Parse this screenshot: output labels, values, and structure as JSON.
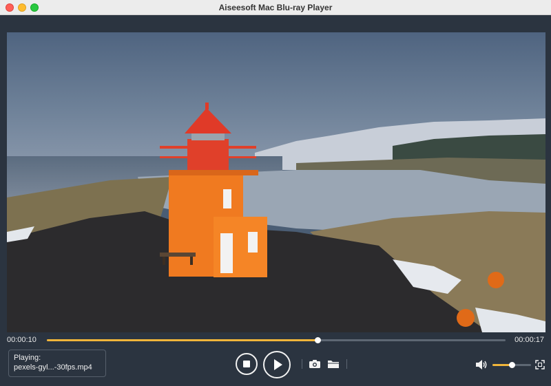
{
  "window": {
    "title": "Aiseesoft Mac Blu-ray Player"
  },
  "video": {
    "scene": "lighthouse-landscape"
  },
  "playback": {
    "current_time": "00:00:10",
    "duration": "00:00:17",
    "progress_fraction": 0.59,
    "volume_fraction": 0.5
  },
  "now_playing": {
    "label": "Playing:",
    "filename": "pexels-gyl...-30fps.mp4"
  },
  "icons": {
    "stop": "stop-icon",
    "play": "play-icon",
    "snapshot": "camera-icon",
    "open": "folder-icon",
    "volume": "speaker-icon",
    "fullscreen": "fullscreen-icon"
  },
  "colors": {
    "accent": "#f0b53a",
    "background": "#2b3440",
    "lighthouse": "#f07a20"
  }
}
